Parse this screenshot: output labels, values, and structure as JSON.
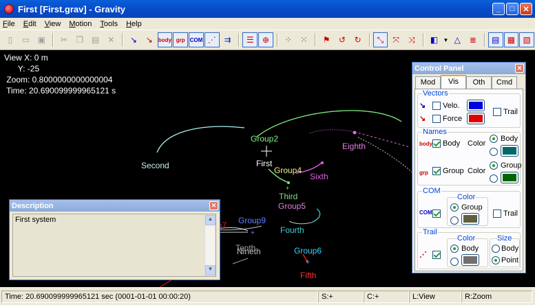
{
  "window": {
    "title": "First [First.grav] - Gravity",
    "buttons": {
      "minimize": "_",
      "maximize": "□",
      "close": "✕"
    }
  },
  "menu": [
    {
      "label": "File",
      "accel": "F",
      "rest": "ile"
    },
    {
      "label": "Edit",
      "accel": "E",
      "rest": "dit"
    },
    {
      "label": "View",
      "accel": "V",
      "rest": "iew"
    },
    {
      "label": "Motion",
      "accel": "M",
      "rest": "otion"
    },
    {
      "label": "Tools",
      "accel": "T",
      "rest": "ools"
    },
    {
      "label": "Help",
      "accel": "H",
      "rest": "elp"
    }
  ],
  "toolbar_icons": {
    "new": "new-file-icon",
    "open": "open-folder-icon",
    "save": "save-icon",
    "cut": "cut-icon",
    "copy": "copy-icon",
    "paste": "paste-icon",
    "delete": "delete-icon",
    "body": "body",
    "grp": "grp",
    "com": "COM"
  },
  "view_info": {
    "x_line": "View X: 0 m",
    "y_line": "      Y: -25",
    "zoom_line": " Zoom: 0.8000000000000004",
    "time_line": " Time: 20.690099999965121 s"
  },
  "canvas_labels": {
    "second": "Second",
    "group2": "Group2",
    "first": "First",
    "group4": "Group4",
    "eighth": "Eighth",
    "sixth": "Sixth",
    "third": "Third",
    "group5": "Group5",
    "group9": "Group9",
    "group7": "Group7",
    "fourth": "Fourth",
    "tenth": "Tenth",
    "nineth": "Nineth",
    "group6": "Group6",
    "fifth": "Fifth"
  },
  "colors": {
    "velocity": "#0000e0",
    "force": "#e00000",
    "names_body": "#006868",
    "names_group": "#006600",
    "com": "#606040",
    "trail": "#707070"
  },
  "control_panel": {
    "title": "Control Panel",
    "close": "✕",
    "tabs": [
      "Mod",
      "Vis",
      "Oth",
      "Cmd"
    ],
    "active_tab": "Vis",
    "vectors": {
      "title": "Vectors",
      "velo_label": "Velo.",
      "force_label": "Force",
      "trail_label": "Trail"
    },
    "names": {
      "title": "Names",
      "body_label": "Body",
      "group_label": "Group",
      "color_label": "Color",
      "color_label2": "Color",
      "radio_body": "Body",
      "radio_group": "Group"
    },
    "com": {
      "title": "COM",
      "color_title": "Color",
      "radio_group": "Group",
      "trail_label": "Trail"
    },
    "trail": {
      "title": "Trail",
      "color_title": "Color",
      "size_title": "Size",
      "radio_body": "Body",
      "size_body": "Body",
      "size_point": "Point"
    }
  },
  "description": {
    "title": "Description",
    "close": "✕",
    "text": "First system"
  },
  "status": {
    "time": "Time: 20.690099999965121 sec (0001-01-01 00:00:20)",
    "s": "S:+",
    "c": "C:+",
    "l": "L:View",
    "r": "R:Zoom"
  }
}
